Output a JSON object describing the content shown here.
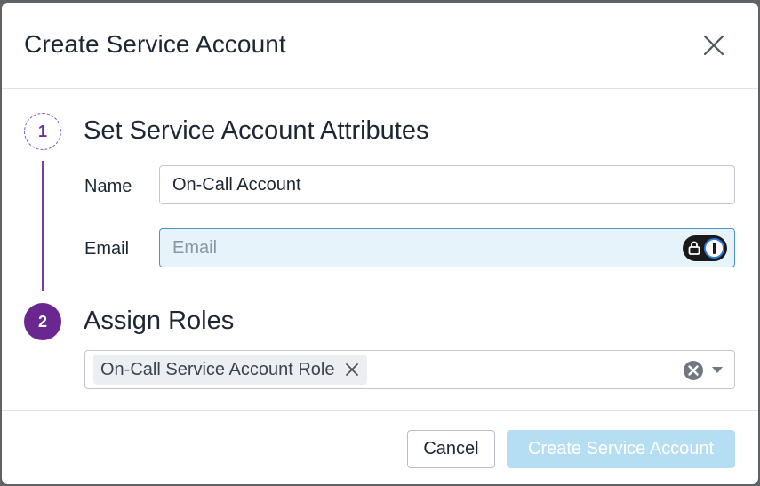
{
  "dialog": {
    "title": "Create Service Account",
    "close_icon": "close-icon"
  },
  "steps": [
    {
      "number": "1",
      "title": "Set Service Account Attributes",
      "state": "active"
    },
    {
      "number": "2",
      "title": "Assign Roles",
      "state": "current"
    }
  ],
  "form": {
    "name_label": "Name",
    "name_value": "On-Call Account",
    "email_label": "Email",
    "email_value": "",
    "email_placeholder": "Email",
    "password_manager_icon": "1password-icon"
  },
  "roles": {
    "selected": [
      "On-Call Service Account Role"
    ],
    "remove_icon": "close-icon",
    "clear_icon": "clear-icon",
    "dropdown_icon": "chevron-down-icon"
  },
  "footer": {
    "cancel_label": "Cancel",
    "create_label": "Create Service Account"
  },
  "colors": {
    "accent": "#6a2790",
    "primary_disabled": "#b6def2",
    "focus_border": "#4b93c8",
    "focus_bg": "#e7f3fb"
  }
}
